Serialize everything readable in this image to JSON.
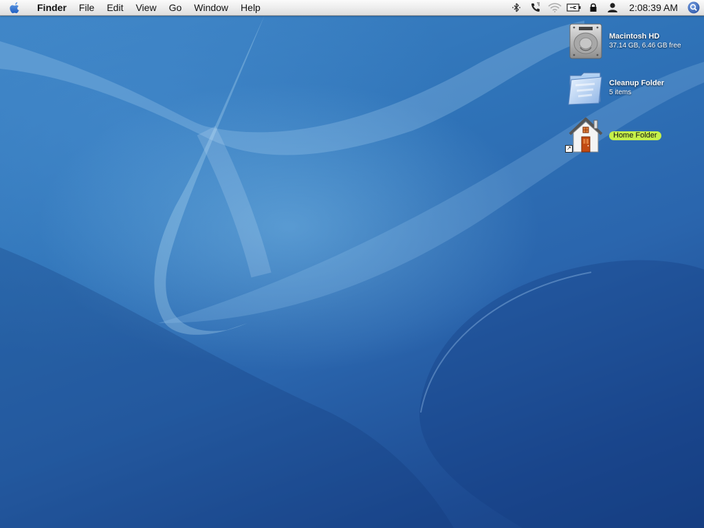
{
  "menubar": {
    "app_name": "Finder",
    "menus": [
      "File",
      "Edit",
      "View",
      "Go",
      "Window",
      "Help"
    ],
    "status_icons": [
      "bluetooth-icon",
      "phone-icon",
      "wifi-icon",
      "battery-icon",
      "lock-icon",
      "user-icon"
    ],
    "clock": "2:08:39 AM",
    "spotlight_icon": "spotlight-search-icon"
  },
  "desktop": {
    "icons": [
      {
        "name": "Macintosh HD",
        "detail": "37.14 GB, 6.46 GB free",
        "icon": "hard-drive-icon"
      },
      {
        "name": "Cleanup Folder",
        "detail": "5 items",
        "icon": "folder-icon"
      },
      {
        "name": "Home Folder",
        "detail": "",
        "icon": "home-icon",
        "highlight_color": "#c5f04a"
      }
    ]
  },
  "colors": {
    "wallpaper_top": "#3f86c7",
    "wallpaper_bottom": "#173f82",
    "menubar": "#ececec",
    "label_highlight": "#c5f04a"
  }
}
